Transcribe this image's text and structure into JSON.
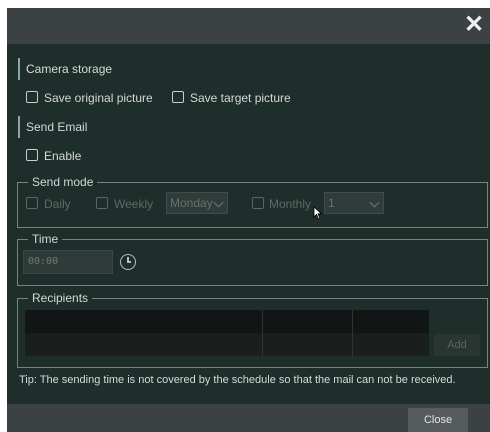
{
  "dialog": {
    "close_icon_glyph": "✕",
    "camera_storage": {
      "title": "Camera storage",
      "save_original_label": "Save original picture",
      "save_original_checked": false,
      "save_target_label": "Save target picture",
      "save_target_checked": false
    },
    "send_email": {
      "title": "Send Email",
      "enable_label": "Enable",
      "enable_checked": false
    },
    "send_mode": {
      "legend": "Send mode",
      "daily_label": "Daily",
      "weekly_label": "Weekly",
      "weekday_value": "Monday",
      "monthly_label": "Monthly",
      "monthday_value": "1"
    },
    "time": {
      "legend": "Time",
      "value": "00:00"
    },
    "recipients": {
      "legend": "Recipients",
      "add_label": "Add"
    },
    "tip": "Tip: The sending time is not covered by the schedule so that the mail can not be received.",
    "footer": {
      "close_label": "Close"
    }
  },
  "colors": {
    "background": "#1e2e2a",
    "bar": "#3c4143",
    "text": "#d4d8d7",
    "disabled_text": "#5e6a67"
  }
}
